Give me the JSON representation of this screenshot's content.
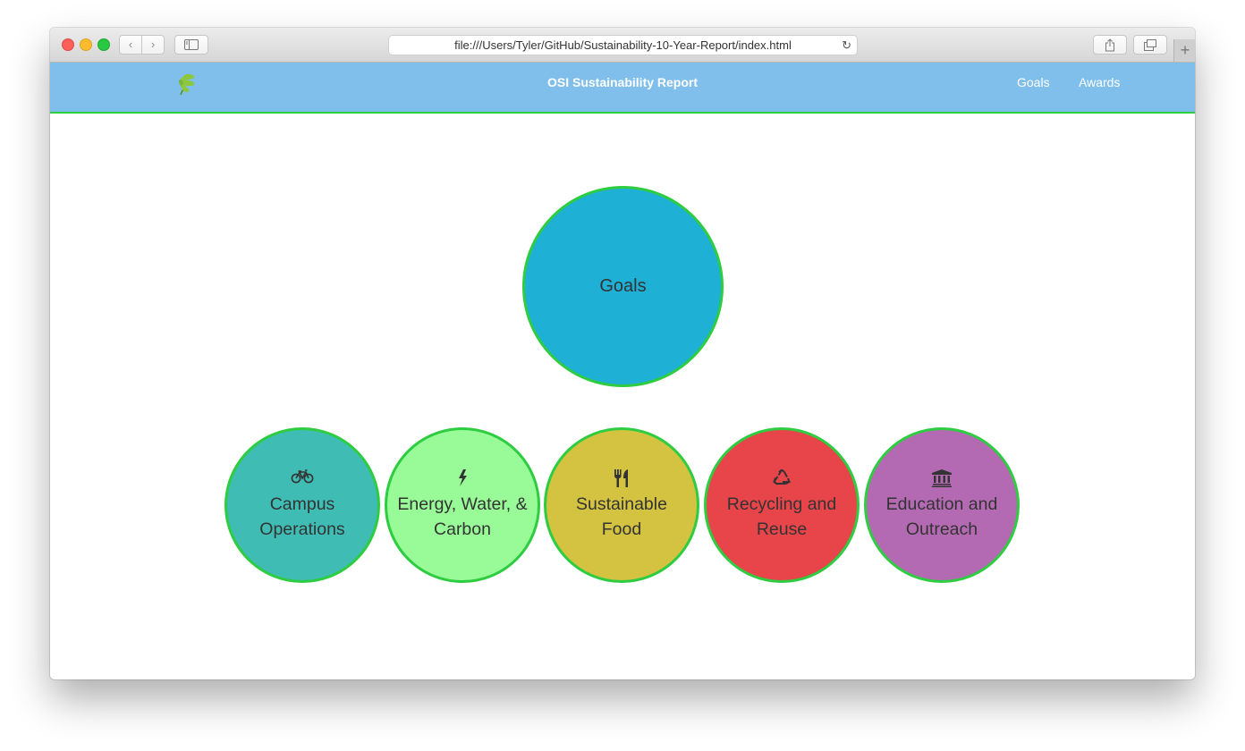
{
  "browser": {
    "url": "file:///Users/Tyler/GitHub/Sustainability-10-Year-Report/index.html",
    "back_glyph": "‹",
    "forward_glyph": "›",
    "new_tab_glyph": "+",
    "reload_glyph": "↻"
  },
  "site": {
    "brand": "OSI Sustainability Report",
    "nav": [
      {
        "label": "Goals"
      },
      {
        "label": "Awards"
      }
    ]
  },
  "main": {
    "goals_label": "Goals",
    "categories": [
      {
        "icon": "bicycle-icon",
        "line1": "Campus",
        "line2": "Operations",
        "color": "#3fbdb5"
      },
      {
        "icon": "lightning-icon",
        "line1": "Energy, Water, &",
        "line2": "Carbon",
        "color": "#98fb98"
      },
      {
        "icon": "cutlery-icon",
        "line1": "Sustainable",
        "line2": "Food",
        "color": "#d3c341"
      },
      {
        "icon": "recycle-icon",
        "line1": "Recycling and",
        "line2": "Reuse",
        "color": "#e8454a"
      },
      {
        "icon": "institution-icon",
        "line1": "Education and",
        "line2": "Outreach",
        "color": "#b46ab3"
      }
    ]
  },
  "colors": {
    "navbar": "#80bfec",
    "accent_border": "#2ecc40",
    "goals_circle": "#1fb0d6"
  }
}
